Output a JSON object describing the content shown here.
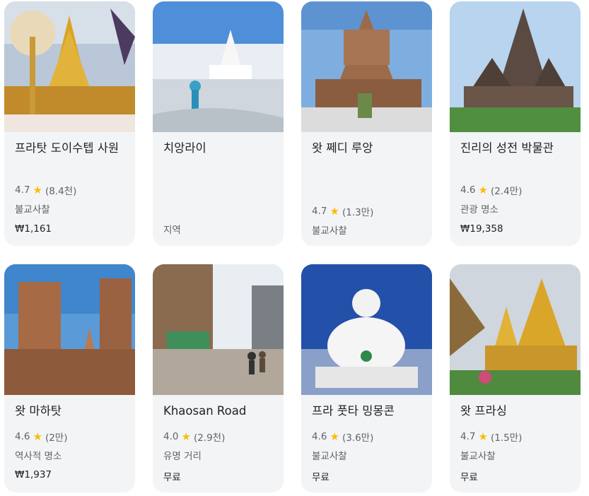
{
  "cards": [
    {
      "title": "프라탓 도이수텝 사원",
      "rating": "4.7",
      "reviews": "(8.4천)",
      "category": "불교사찰",
      "price": "₩1,161"
    },
    {
      "title": "치앙라이",
      "category": "지역"
    },
    {
      "title": "왓 쩨디 루앙",
      "rating": "4.7",
      "reviews": "(1.3만)",
      "category": "불교사찰"
    },
    {
      "title": "진리의 성전 박물관",
      "rating": "4.6",
      "reviews": "(2.4만)",
      "category": "관광 명소",
      "price": "₩19,358"
    },
    {
      "title": "왓 마하탓",
      "rating": "4.6",
      "reviews": "(2만)",
      "category": "역사적 명소",
      "price": "₩1,937"
    },
    {
      "title": "Khaosan Road",
      "rating": "4.0",
      "reviews": "(2.9천)",
      "category": "유명 거리",
      "price": "무료"
    },
    {
      "title": "프라 풋타 밍몽콘",
      "rating": "4.6",
      "reviews": "(3.6만)",
      "category": "불교사찰",
      "price": "무료"
    },
    {
      "title": "왓 프라싱",
      "rating": "4.7",
      "reviews": "(1.5만)",
      "category": "불교사찰",
      "price": "무료"
    }
  ],
  "colors": {
    "card_bg": "#f3f4f6",
    "star": "#fbbc04",
    "text": "#202124",
    "secondary": "#5f6368"
  },
  "icons": {
    "rating_icon": "star-icon"
  }
}
